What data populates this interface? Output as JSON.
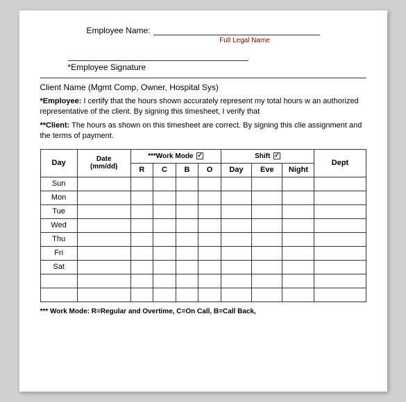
{
  "header": {
    "employee_name_label": "Employee Name: ",
    "full_legal_name_hint": "Full Legal Name",
    "signature_label": "*Employee Signature",
    "client_name": "Client Name (Mgmt Comp, Owner, Hospital Sys)"
  },
  "certify": {
    "employee_text": "*Employee:",
    "employee_body": " I certify that the hours shown accurately represent my total hours w an authorized representative of the client. By signing this timesheet, I verify that",
    "client_text": "**Client:",
    "client_body": "  The hours as shown on this timesheet are correct.  By signing this clie assignment and the terms of payment."
  },
  "table": {
    "col_day": "Day",
    "col_date": "Date\n(mm/dd)",
    "col_workmode": "***Work Mode",
    "col_r": "R",
    "col_c": "C",
    "col_b": "B",
    "col_o": "O",
    "col_shift": "Shift",
    "col_shift_day": "Day",
    "col_shift_eve": "Eve",
    "col_shift_night": "Night",
    "col_dept": "Dept",
    "days": [
      "Sun",
      "Mon",
      "Tue",
      "Wed",
      "Thu",
      "Fri",
      "Sat"
    ],
    "extra_rows": 2
  },
  "footer": {
    "work_mode_note": "*** Work Mode: R=Regular and Overtime, C=On Call, B=Call Back,"
  }
}
